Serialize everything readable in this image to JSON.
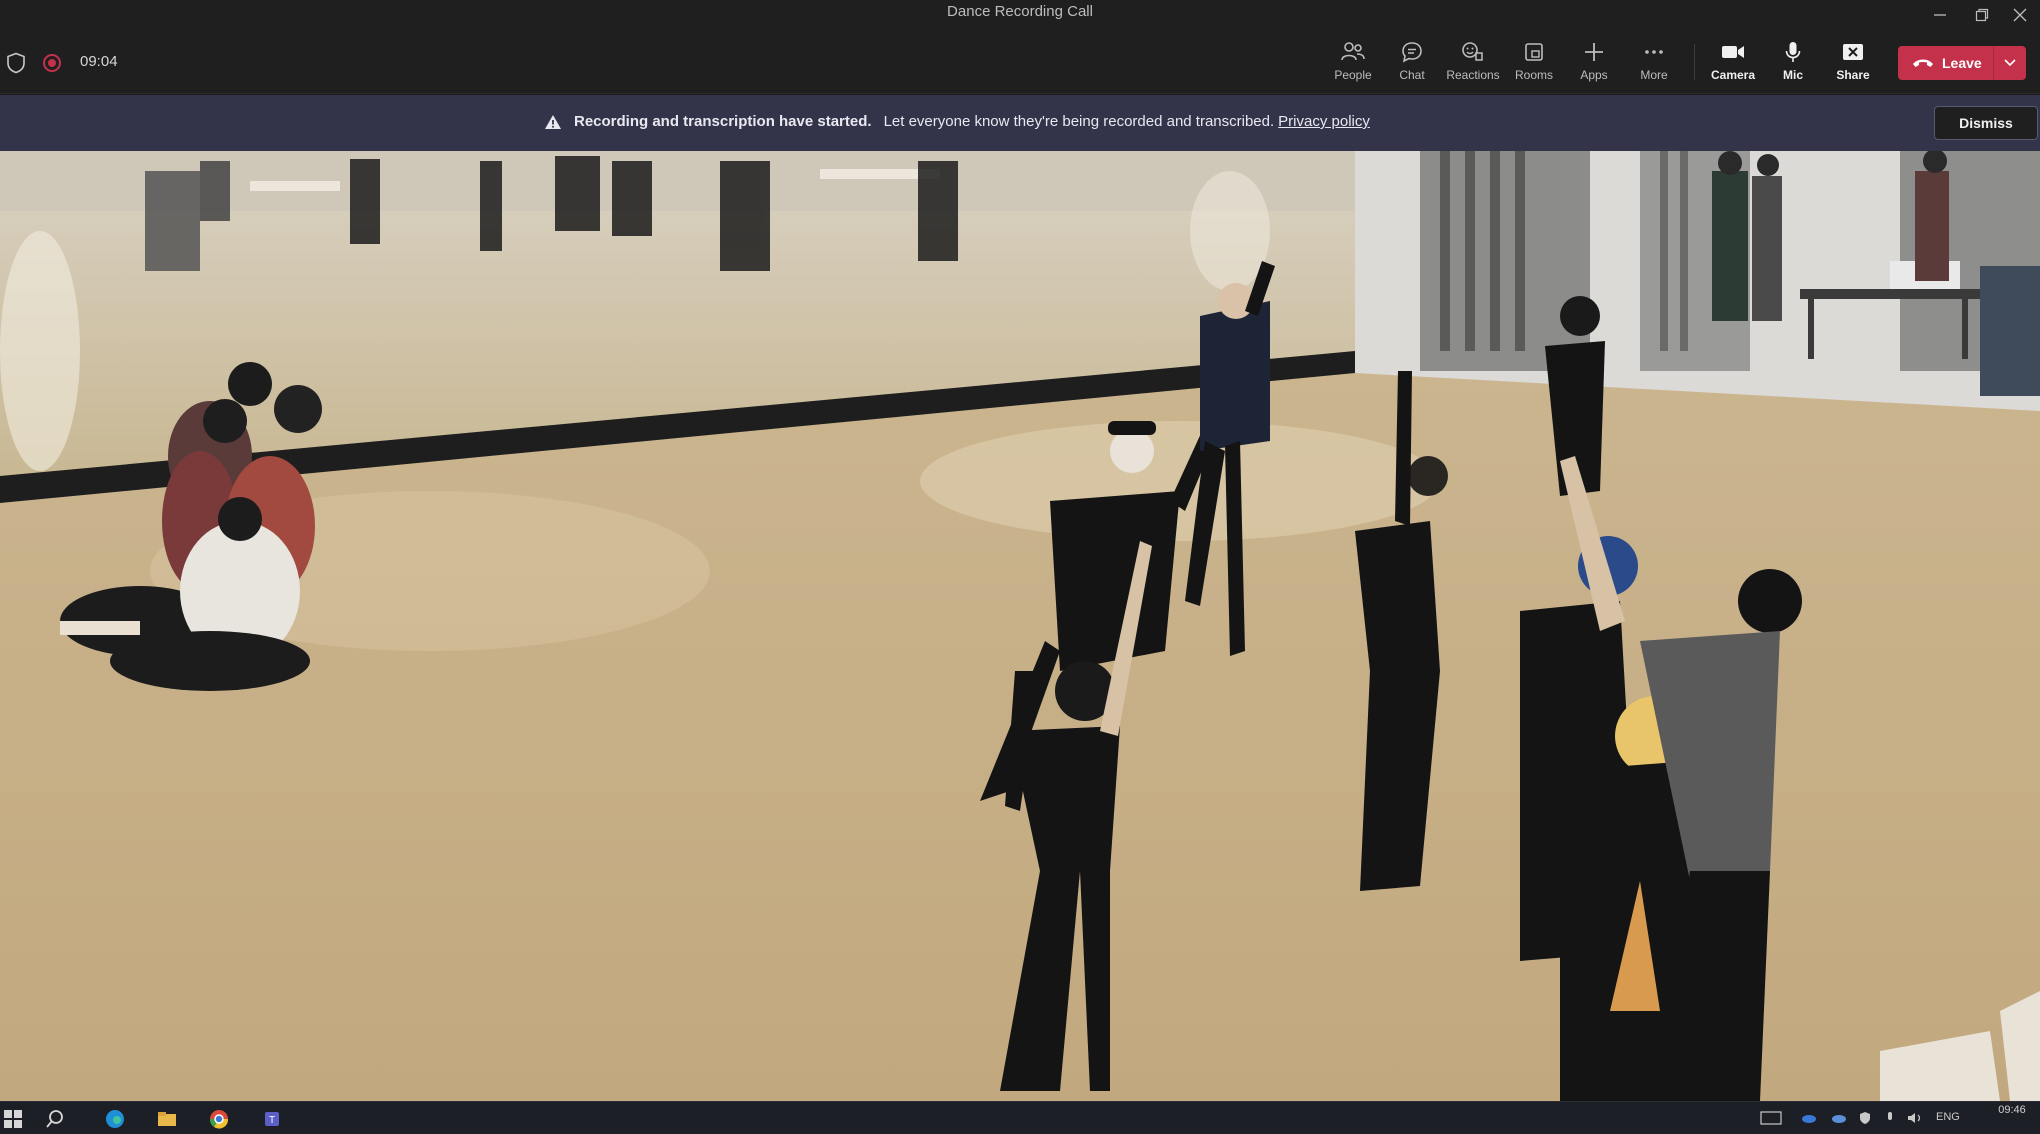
{
  "window": {
    "title": "Dance Recording Call",
    "controls": [
      "minimize",
      "restore",
      "close"
    ]
  },
  "toolbar": {
    "timer": "09:04",
    "items": [
      {
        "label": "People",
        "icon": "people-icon"
      },
      {
        "label": "Chat",
        "icon": "chat-icon"
      },
      {
        "label": "Reactions",
        "icon": "reactions-icon"
      },
      {
        "label": "Rooms",
        "icon": "rooms-icon"
      },
      {
        "label": "Apps",
        "icon": "apps-icon"
      },
      {
        "label": "More",
        "icon": "more-icon"
      },
      {
        "label": "Camera",
        "icon": "camera-icon"
      },
      {
        "label": "Mic",
        "icon": "mic-icon"
      },
      {
        "label": "Share",
        "icon": "share-icon"
      }
    ],
    "leave_label": "Leave",
    "leave_color": "#c4314b"
  },
  "banner": {
    "bold_text": "Recording and transcription have started.",
    "text": "Let everyone know they're being recorded and transcribed.",
    "link": "Privacy policy",
    "dismiss_label": "Dismiss",
    "background": "#33344a"
  },
  "taskbar": {
    "tray_language": "ENG",
    "time": "09:46"
  }
}
